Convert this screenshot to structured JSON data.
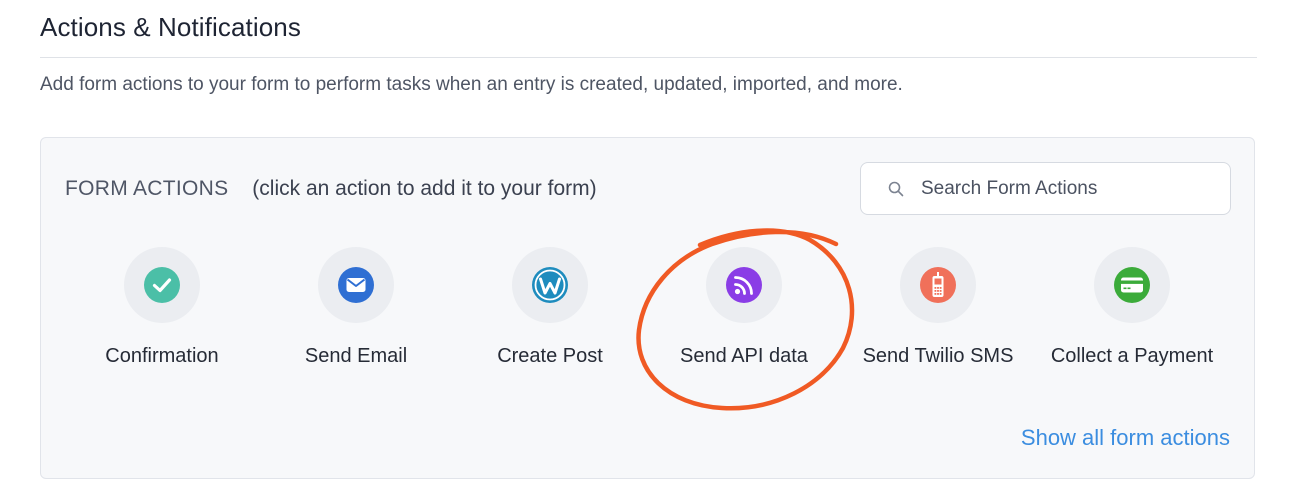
{
  "section": {
    "title": "Actions & Notifications",
    "description": "Add form actions to your form to perform tasks when an entry is created, updated, imported, and more."
  },
  "panel": {
    "heading_caps": "FORM ACTIONS",
    "heading_hint": "(click an action to add it to your form)",
    "search": {
      "placeholder": "Search Form Actions",
      "value": ""
    },
    "actions": [
      {
        "label": "Confirmation",
        "icon": "check-circle-icon",
        "color": "#4bbfa7"
      },
      {
        "label": "Send Email",
        "icon": "email-icon",
        "color": "#2f6fd3"
      },
      {
        "label": "Create Post",
        "icon": "wordpress-icon",
        "color": "#1e8cbe"
      },
      {
        "label": "Send API data",
        "icon": "rss-feed-icon",
        "color": "#8a3de6"
      },
      {
        "label": "Send Twilio SMS",
        "icon": "mobile-phone-icon",
        "color": "#f0705a"
      },
      {
        "label": "Collect a Payment",
        "icon": "credit-card-icon",
        "color": "#3bab3a"
      }
    ],
    "show_all_label": "Show all form actions"
  },
  "colors": {
    "link": "#3b8de0",
    "annotation_circle": "#f05a24",
    "panel_background": "#f7f8fa"
  }
}
